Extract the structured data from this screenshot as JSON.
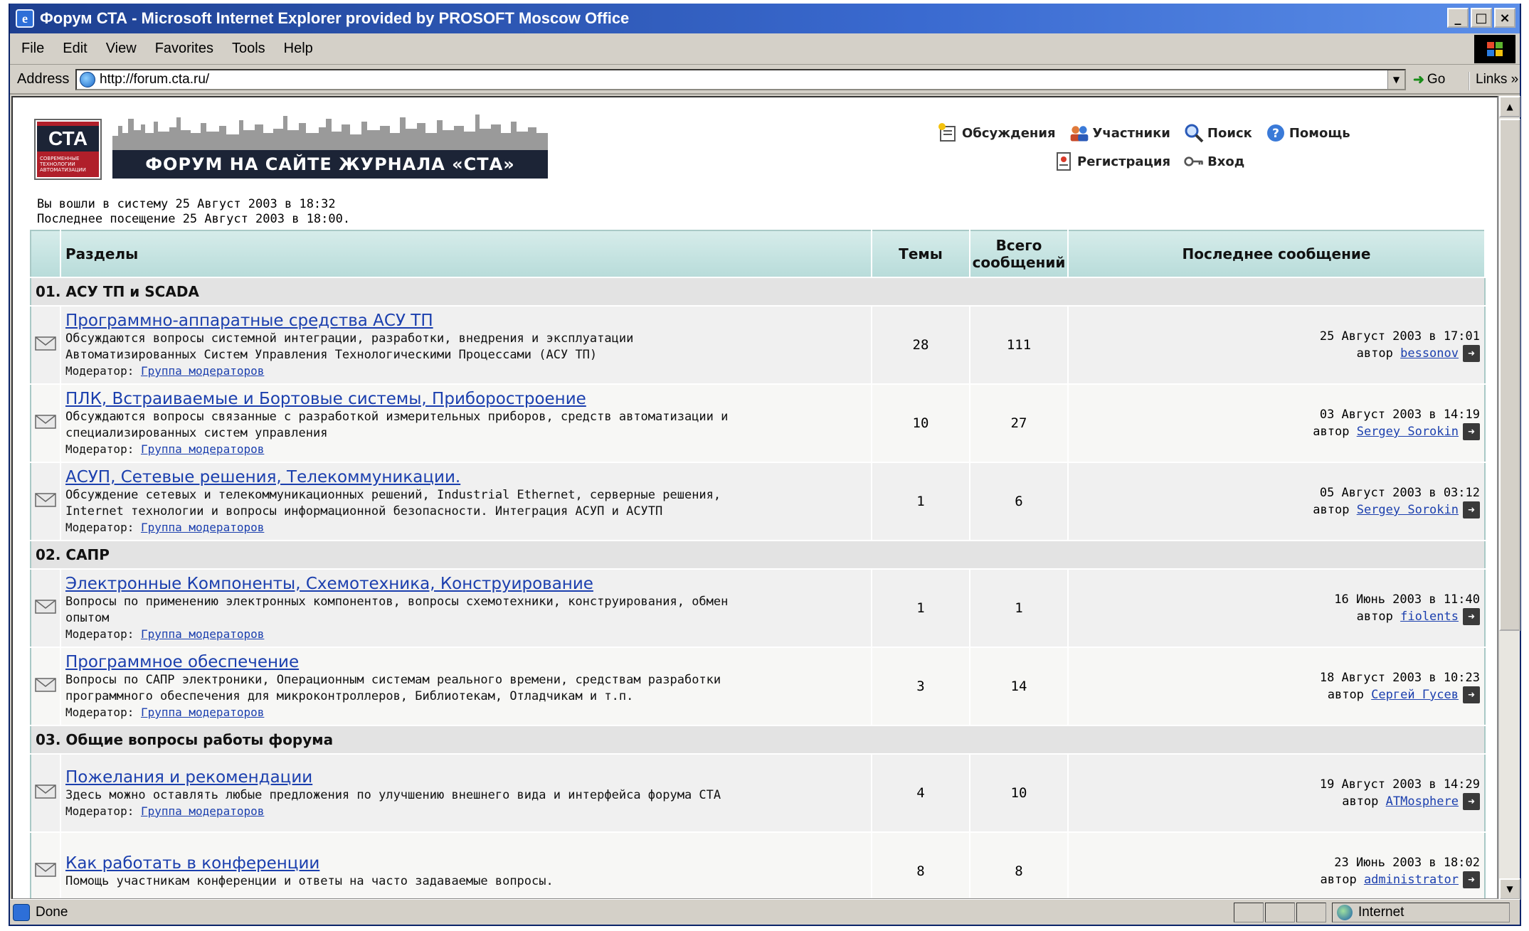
{
  "window": {
    "title": "Форум СТА - Microsoft Internet Explorer provided by PROSOFT Moscow Office",
    "controls": [
      "_",
      "□",
      "×"
    ]
  },
  "menu": [
    "File",
    "Edit",
    "View",
    "Favorites",
    "Tools",
    "Help"
  ],
  "addressbar": {
    "label": "Address",
    "url": "http://forum.cta.ru/",
    "go": "Go",
    "links": "Links »"
  },
  "header": {
    "logo_text": "СТА",
    "logo_sub": "СОВРЕМЕННЫЕ ТЕХНОЛОГИИ АВТОМАТИЗАЦИИ",
    "banner": "ФОРУМ НА САЙТЕ ЖУРНАЛА «СТА»"
  },
  "nav": {
    "discussions": "Обсуждения",
    "members": "Участники",
    "search": "Поиск",
    "help": "Помощь",
    "register": "Регистрация",
    "login": "Вход"
  },
  "session": {
    "logged_in": "Вы вошли в систему 25 Август 2003 в 18:32",
    "last_visit": "Последнее посещение 25 Август 2003 в 18:00."
  },
  "table": {
    "col_sections": "Разделы",
    "col_topics": "Темы",
    "col_posts_1": "Всего",
    "col_posts_2": "сообщений",
    "col_last": "Последнее сообщение",
    "moderator_label": "Модератор:",
    "author_label": "автор"
  },
  "categories": [
    {
      "name": "01. АСУ ТП и SCADA",
      "forums": [
        {
          "title": "Программно-аппаратные средства АСУ ТП",
          "desc1": "Обсуждаются вопросы системной интеграции, разработки, внедрения и эксплуатации",
          "desc2": "Автоматизированных Систем Управления Технологическими Процессами (АСУ ТП)",
          "moderator": "Группа модераторов",
          "topics": "28",
          "posts": "111",
          "last_date": "25 Август 2003 в 17:01",
          "last_author": "bessonov"
        },
        {
          "title": "ПЛК, Встраиваемые и Бортовые системы, Приборостроение",
          "desc1": "Обсуждаются вопросы связанные с разработкой измерительных приборов, средств автоматизации и",
          "desc2": "специализированных систем управления",
          "moderator": "Группа модераторов",
          "topics": "10",
          "posts": "27",
          "last_date": "03 Август 2003 в 14:19",
          "last_author": "Sergey Sorokin"
        },
        {
          "title": "АСУП, Сетевые решения, Телекоммуникации.",
          "desc1": "Обсуждение сетевых и телекоммуникационных решений, Industrial Ethernet, серверные решения,",
          "desc2": "Internet технологии и вопросы информационной безопасности. Интеграция АСУП и АСУТП",
          "moderator": "Группа модераторов",
          "topics": "1",
          "posts": "6",
          "last_date": "05 Август 2003 в 03:12",
          "last_author": "Sergey Sorokin"
        }
      ]
    },
    {
      "name": "02. САПР",
      "forums": [
        {
          "title": "Электронные Компоненты, Схемотехника, Конструирование",
          "desc1": "Вопросы по применению электронных компонентов, вопросы схемотехники, конструирования, обмен",
          "desc2": "опытом",
          "moderator": "Группа модераторов",
          "topics": "1",
          "posts": "1",
          "last_date": "16 Июнь 2003 в 11:40",
          "last_author": "fiolents"
        },
        {
          "title": "Программное обеспечение",
          "desc1": "Вопросы по САПР электроники, Операционным системам реального времени, средствам разработки",
          "desc2": "программного обеспечения для микроконтроллеров, Библиотекам, Отладчикам и т.п.",
          "moderator": "Группа модераторов",
          "topics": "3",
          "posts": "14",
          "last_date": "18 Август 2003 в 10:23",
          "last_author": "Сергей Гусев"
        }
      ]
    },
    {
      "name": "03. Общие вопросы работы форума",
      "forums": [
        {
          "title": "Пожелания и рекомендации",
          "desc1": "Здесь можно оставлять любые предложения по улучшению внешнего вида и интерфейса форума СТА",
          "desc2": "",
          "moderator": "Группа модераторов",
          "topics": "4",
          "posts": "10",
          "last_date": "19 Август 2003 в 14:29",
          "last_author": "ATMosphere"
        },
        {
          "title": "Как работать в конференции",
          "desc1": "Помощь участникам конференции и ответы на часто задаваемые вопросы.",
          "desc2": "",
          "moderator": "",
          "topics": "8",
          "posts": "8",
          "last_date": "23 Июнь 2003 в 18:02",
          "last_author": "administrator"
        }
      ]
    }
  ],
  "status": {
    "text": "Done",
    "zone": "Internet"
  },
  "colors": {
    "titlebar": "#1d3f90",
    "link": "#1b3fae",
    "header_bg": "#b8dcda",
    "banner_bg": "#1c2436",
    "logo_red": "#b01f2a"
  }
}
